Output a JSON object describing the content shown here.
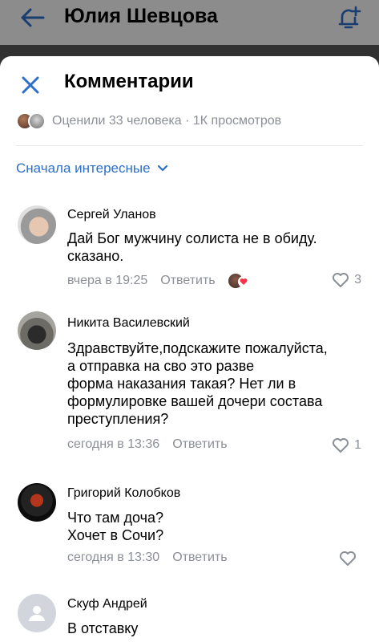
{
  "background": {
    "title": "Юлия Шевцова"
  },
  "sheet": {
    "title": "Комментарии",
    "stats": "Оценили 33 человека · 1К просмотров",
    "sort_label": "Сначала интересные"
  },
  "colors": {
    "accent": "#2c6fcb",
    "secondary_text": "#8b8f96",
    "like_heart": "#8b8f96"
  },
  "comments": [
    {
      "author": "Сергей Уланов",
      "text": "Дай Бог мужчину солиста не в обиду.\nсказано.",
      "time": "вчера в 19:25",
      "reply_label": "Ответить",
      "likes": "3",
      "has_reaction": true
    },
    {
      "author": "Никита Василевский",
      "text": "Здравствуйте,подскажите пожалуйста,\nа отправка на сво это разве\nформа наказания такая? Нет ли в\nформулировке вашей дочери состава\nпреступления?",
      "time": "сегодня в 13:36",
      "reply_label": "Ответить",
      "likes": "1"
    },
    {
      "author": "Григорий Колобков",
      "text": "Что там доча?\nХочет в Сочи?",
      "time": "сегодня в 13:30",
      "reply_label": "Ответить",
      "likes": ""
    },
    {
      "author": "Скуф Андрей",
      "text": "В отставку"
    }
  ],
  "icons": [
    "back-arrow-icon",
    "bell-add-icon",
    "close-icon",
    "chevron-down-icon",
    "heart-outline-icon",
    "reaction-heart-icon",
    "user-placeholder-icon"
  ]
}
